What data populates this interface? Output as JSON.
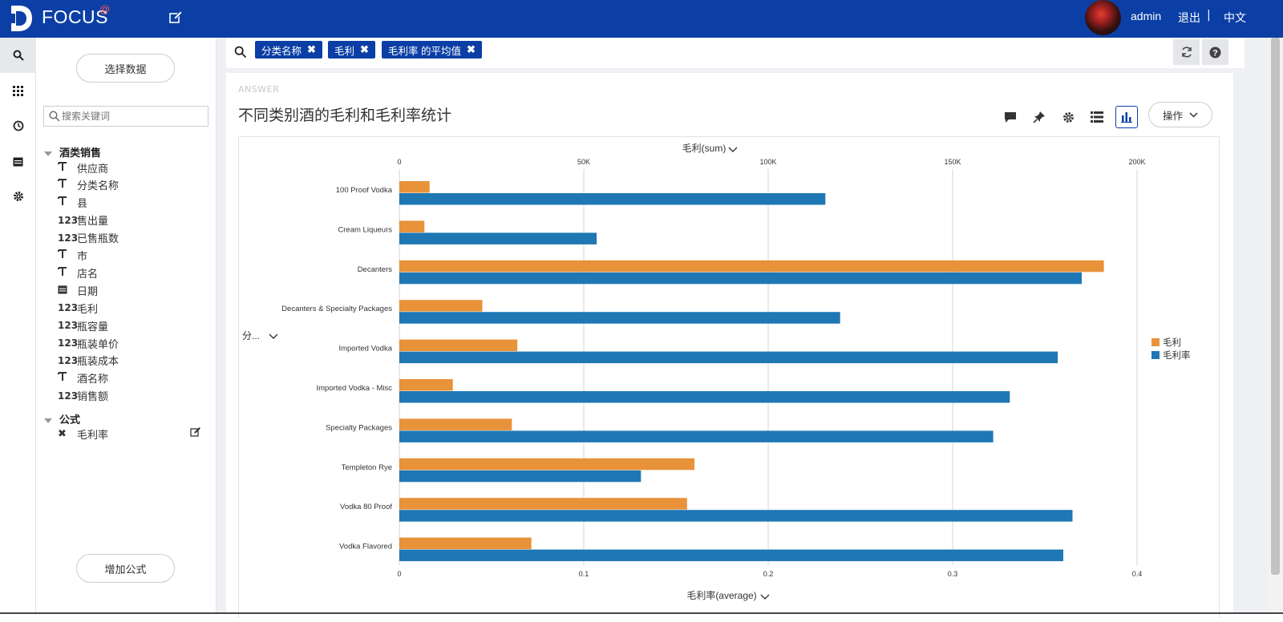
{
  "header": {
    "brand": "FOCUS",
    "brand_sup": "@",
    "username": "admin",
    "logout": "退出",
    "separator": "|",
    "language": "中文"
  },
  "iconbar": {
    "icons": [
      "search-icon",
      "apps-grid-icon",
      "clock-icon",
      "calendar-icon",
      "gear-icon"
    ]
  },
  "sidebar": {
    "select_data_button": "选择数据",
    "search_placeholder": "搜索关键词",
    "table_name": "酒类销售",
    "fields": [
      {
        "type": "T",
        "label": "供应商"
      },
      {
        "type": "T",
        "label": "分类名称"
      },
      {
        "type": "T",
        "label": "县"
      },
      {
        "type": "123",
        "label": "售出量"
      },
      {
        "type": "123",
        "label": "已售瓶数"
      },
      {
        "type": "T",
        "label": "市"
      },
      {
        "type": "T",
        "label": "店名"
      },
      {
        "type": "date",
        "label": "日期"
      },
      {
        "type": "123",
        "label": "毛利"
      },
      {
        "type": "123",
        "label": "瓶容量"
      },
      {
        "type": "123",
        "label": "瓶装单价"
      },
      {
        "type": "123",
        "label": "瓶装成本"
      },
      {
        "type": "T",
        "label": "酒名称"
      },
      {
        "type": "123",
        "label": "销售额"
      }
    ],
    "formula_group": "公式",
    "formulas": [
      {
        "label": "毛利率"
      }
    ],
    "add_formula_button": "增加公式"
  },
  "query": {
    "chips": [
      "分类名称",
      "毛利",
      "毛利率 的平均值"
    ],
    "chip_close": "✖"
  },
  "answer": {
    "label": "ANSWER",
    "title": "不同类别酒的毛利和毛利率统计",
    "operate_button": "操作"
  },
  "chart_data": {
    "type": "bar",
    "orientation": "horizontal",
    "categories": [
      "100 Proof Vodka",
      "Cream Liqueurs",
      "Decanters",
      "Decanters & Specialty Packages",
      "Imported Vodka",
      "Imported Vodka - Misc",
      "Specialty Packages",
      "Templeton Rye",
      "Vodka 80 Proof",
      "Vodka Flavored"
    ],
    "series": [
      {
        "name": "毛利",
        "axis": "top",
        "color": "#e8923a",
        "values": [
          8200,
          6800,
          191000,
          22500,
          32000,
          14500,
          30500,
          80000,
          78000,
          35800
        ]
      },
      {
        "name": "毛利率",
        "axis": "bottom",
        "color": "#1f77b4",
        "values": [
          0.231,
          0.107,
          0.37,
          0.239,
          0.357,
          0.331,
          0.322,
          0.131,
          0.365,
          0.36
        ]
      }
    ],
    "top_axis": {
      "label": "毛利(sum)",
      "ticks": [
        "0",
        "50K",
        "100K",
        "150K",
        "200K"
      ],
      "range": [
        0,
        200000
      ]
    },
    "bottom_axis": {
      "label": "毛利率(average)",
      "ticks": [
        "0",
        "0.1",
        "0.2",
        "0.3",
        "0.4"
      ],
      "range": [
        0,
        0.4
      ]
    },
    "y_axis_label": "分...",
    "legend": [
      "毛利",
      "毛利率"
    ],
    "legend_position": "right",
    "grid": true
  }
}
